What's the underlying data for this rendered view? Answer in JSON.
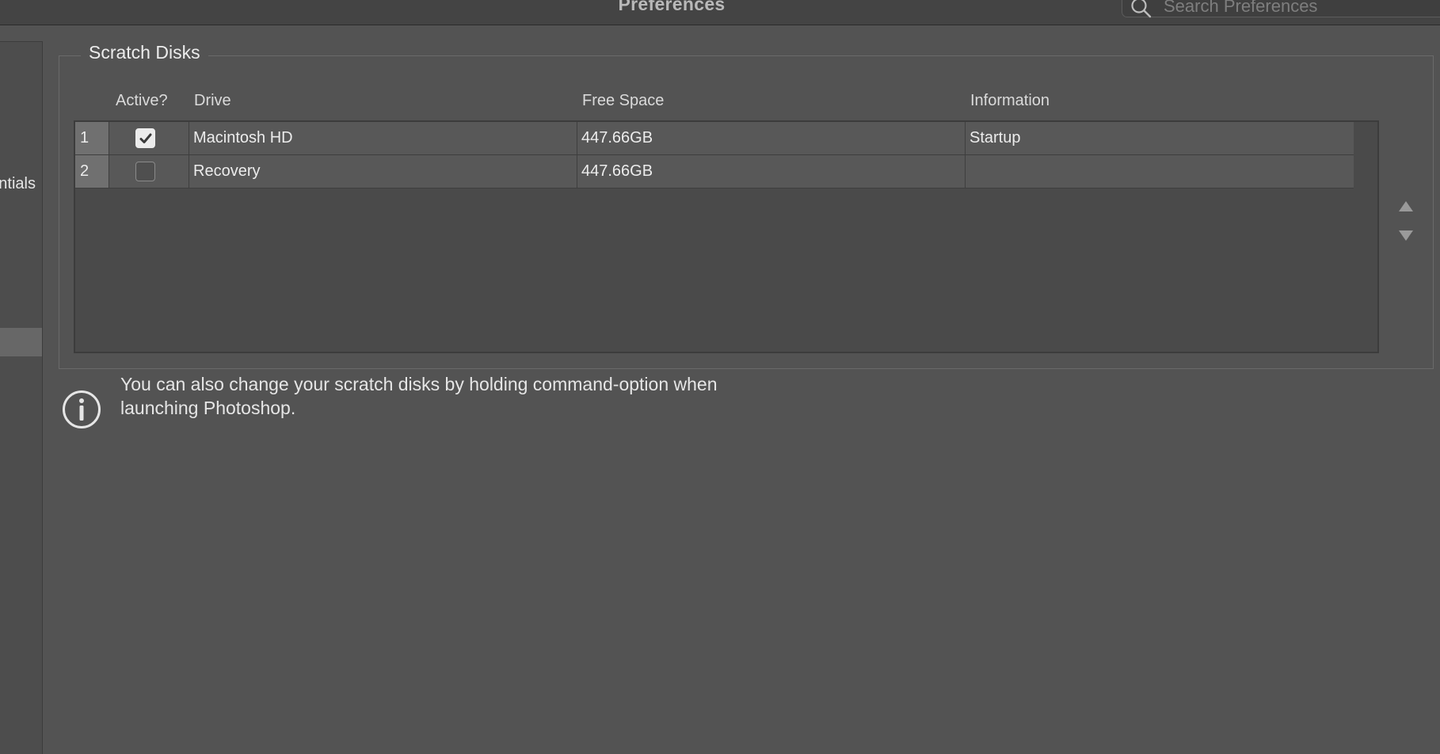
{
  "window": {
    "title": "Preferences",
    "search_placeholder": "Search Preferences"
  },
  "sidebar": {
    "visible_item_label": "ntials"
  },
  "scratch_disks": {
    "group_title": "Scratch Disks",
    "columns": {
      "active": "Active?",
      "drive": "Drive",
      "free_space": "Free Space",
      "information": "Information"
    },
    "rows": [
      {
        "index": "1",
        "active": true,
        "drive": "Macintosh HD",
        "free_space": "447.66GB",
        "information": "Startup"
      },
      {
        "index": "2",
        "active": false,
        "drive": "Recovery",
        "free_space": "447.66GB",
        "information": ""
      }
    ]
  },
  "info_note": {
    "line1": "You can also change your scratch disks by holding command-option when",
    "line2": "launching Photoshop."
  },
  "icons": {
    "search": "search-icon",
    "info": "info-icon",
    "move_up": "triangle-up-icon",
    "move_down": "triangle-down-icon",
    "check": "checkmark-icon"
  },
  "colors": {
    "background": "#535353",
    "titlebar": "#444444",
    "table_row": "#585858",
    "row_number_cell": "#707070",
    "text": "#e8e8e8"
  }
}
